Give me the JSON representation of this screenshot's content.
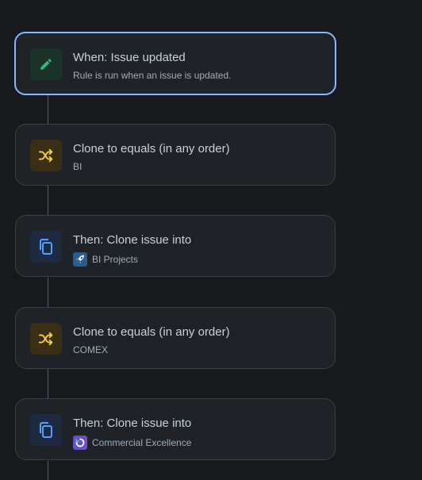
{
  "rule": {
    "steps": [
      {
        "type": "trigger",
        "icon": "pencil-icon",
        "title": "When: Issue updated",
        "subtitle": "Rule is run when an issue is updated.",
        "selected": true
      },
      {
        "type": "condition",
        "icon": "shuffle-icon",
        "title": "Clone to equals (in any order)",
        "subtitle": "BI"
      },
      {
        "type": "action",
        "icon": "copy-icon",
        "title": "Then: Clone issue into",
        "subtitle": "BI Projects",
        "project_icon": "rocket-icon"
      },
      {
        "type": "condition",
        "icon": "shuffle-icon",
        "title": "Clone to equals (in any order)",
        "subtitle": "COMEX"
      },
      {
        "type": "action",
        "icon": "copy-icon",
        "title": "Then: Clone issue into",
        "subtitle": "Commercial Excellence",
        "project_icon": "swirl-icon"
      }
    ]
  },
  "colors": {
    "background": "#17191c",
    "card": "#1f2226",
    "selected_border": "#85b8ff",
    "trigger_green": "#22a06b",
    "condition_yellow": "#e2b203",
    "action_blue": "#579dff"
  }
}
